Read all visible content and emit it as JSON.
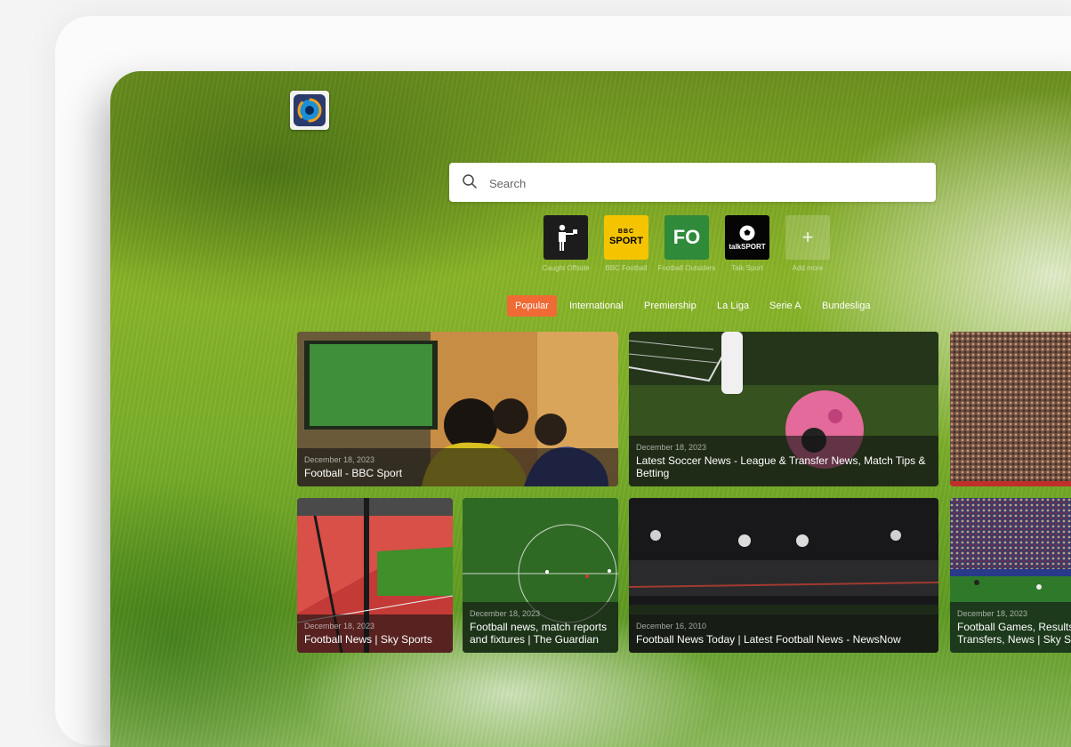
{
  "search": {
    "placeholder": "Search"
  },
  "shortcuts": [
    {
      "label": "Caught Offside",
      "icon": "referee-icon"
    },
    {
      "label": "BBC Football",
      "icon": "bbc-sport-logo",
      "logo_text": [
        "BBC",
        "SPORT"
      ]
    },
    {
      "label": "Football Outsiders",
      "icon": "fo-logo",
      "logo_text": "FO"
    },
    {
      "label": "Talk Sport",
      "icon": "talksport-logo",
      "logo_text": "talkSPORT"
    },
    {
      "label": "Add more",
      "icon": "plus-icon"
    }
  ],
  "tabs": [
    {
      "label": "Popular",
      "active": true
    },
    {
      "label": "International",
      "active": false
    },
    {
      "label": "Premiership",
      "active": false
    },
    {
      "label": "La Liga",
      "active": false
    },
    {
      "label": "Serie A",
      "active": false
    },
    {
      "label": "Bundesliga",
      "active": false
    }
  ],
  "cards": [
    {
      "date": "December 18, 2023",
      "title": "Football - BBC Sport"
    },
    {
      "date": "December 18, 2023",
      "title": "Latest Soccer News - League & Transfer News, Match Tips & Betting"
    },
    {
      "date": "",
      "title": ""
    },
    {
      "date": "December 18, 2023",
      "title": "Football News | Sky Sports"
    },
    {
      "date": "December 18, 2023",
      "title": "Football news, match reports and fixtures | The Guardian"
    },
    {
      "date": "December 16, 2010",
      "title": "Football News Today | Latest Football News - NewsNow"
    },
    {
      "date": "December 18, 2023",
      "title": "Football Games, Results, Transfers, News | Sky S"
    }
  ],
  "colors": {
    "accent": "#f06a35",
    "bbc_yellow": "#f5c400",
    "fo_green": "#2f8a3a"
  }
}
